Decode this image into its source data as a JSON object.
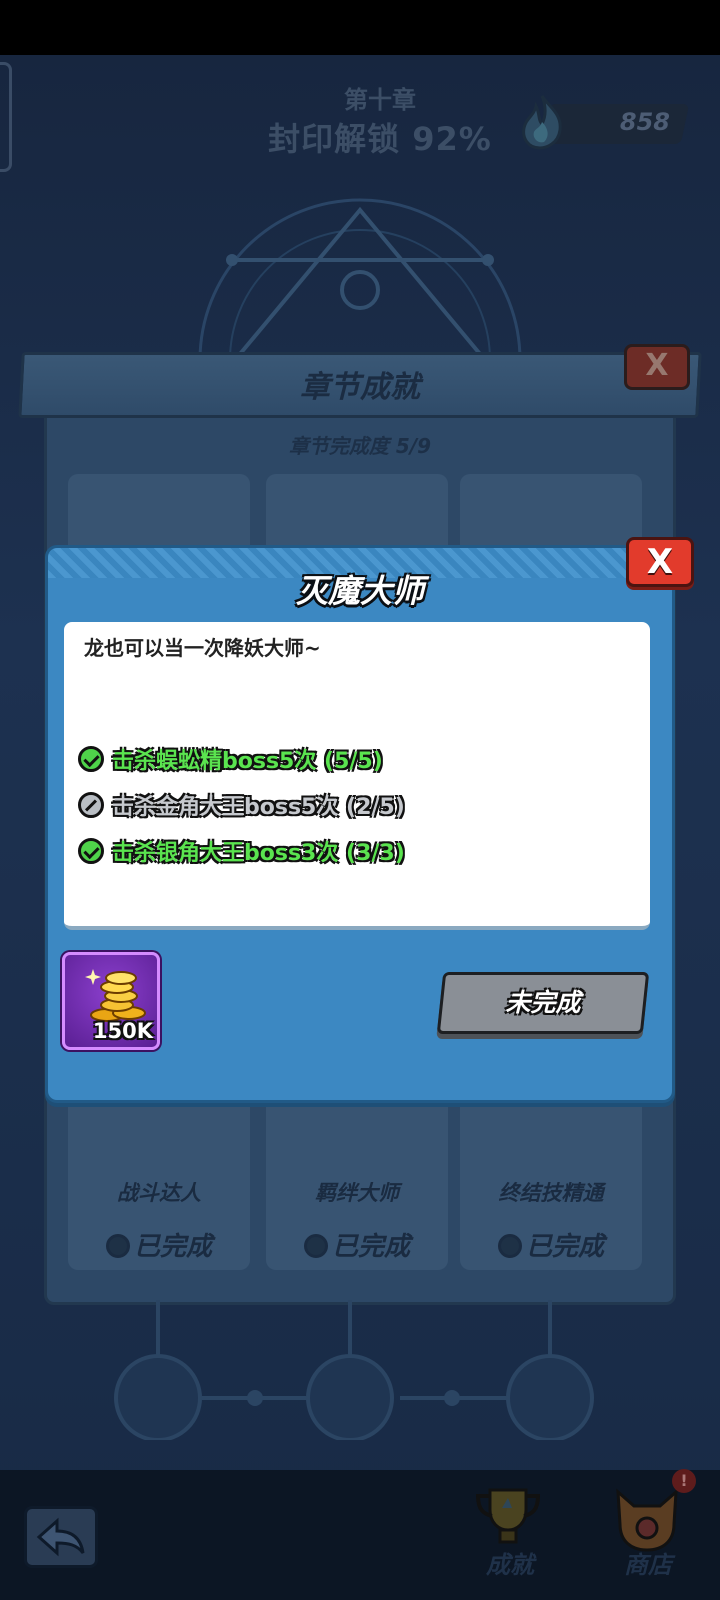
{
  "header": {
    "chapter": "第十章",
    "seal_progress": "封印解锁 92%",
    "gem_count": "858",
    "gem_icon": "soul-flame-icon"
  },
  "background_panel": {
    "title": "章节成就",
    "close_label": "X",
    "subtitle": "章节完成度 5/9",
    "cards": [
      {
        "label": "战斗达人",
        "status": "已完成"
      },
      {
        "label": "羁绊大师",
        "status": "已完成"
      },
      {
        "label": "终结技精通",
        "status": "已完成"
      }
    ]
  },
  "dialog": {
    "title": "灭魔大师",
    "close_label": "X",
    "description": "龙也可以当一次降妖大师~",
    "requirements": [
      {
        "text": "击杀蜈蚣精boss5次 (5/5)",
        "done": true
      },
      {
        "text": "击杀金角大王boss5次 (2/5)",
        "done": false
      },
      {
        "text": "击杀银角大王boss3次 (3/3)",
        "done": true
      }
    ],
    "reward": {
      "amount": "150K",
      "icon": "gold-coins-icon"
    },
    "status_button": "未完成"
  },
  "bottom_nav": {
    "achievements_label": "成就",
    "shop_label": "商店",
    "shop_badge": "!"
  },
  "colors": {
    "dialog_bg": "#3c88c2",
    "done_green": "#5ae44f",
    "close_red": "#e23b2c",
    "reward_purple": "#8b3fcd"
  }
}
